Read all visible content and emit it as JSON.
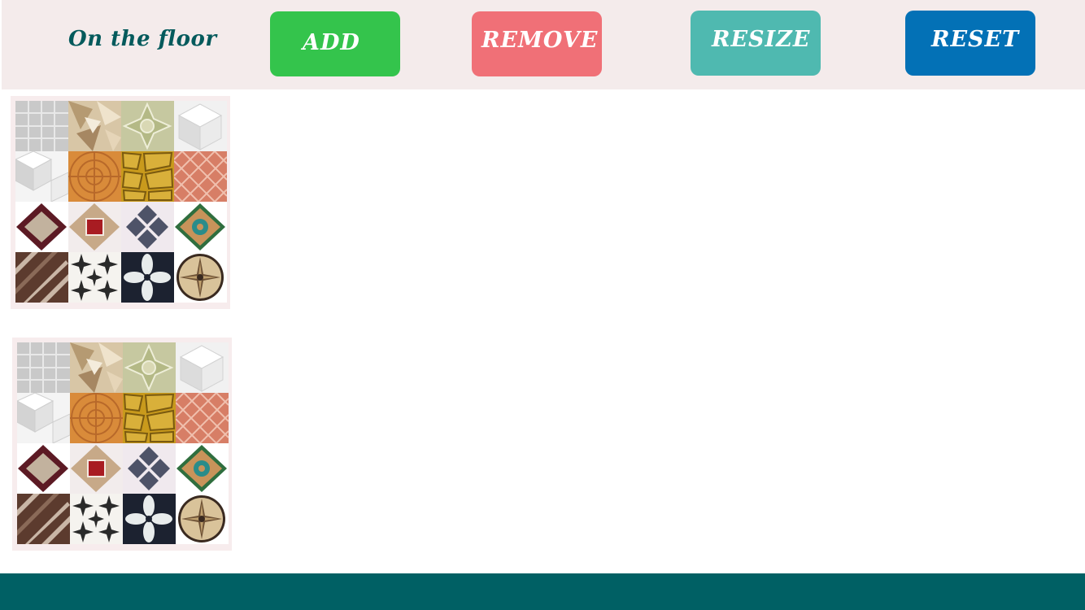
{
  "header": {
    "title": "On the floor",
    "buttons": {
      "add": "ADD",
      "remove": "REMOVE",
      "resize": "RESIZE",
      "reset": "RESET"
    }
  },
  "colors": {
    "header_bg": "#f4ebeb",
    "title": "#045a5c",
    "add": "#34c44c",
    "remove": "#f07077",
    "resize": "#4fb9b0",
    "reset": "#0371b6",
    "footer": "#006064"
  },
  "palettes": [
    {
      "name": "tile-palette-1",
      "tiles": [
        "grey-grid-tile",
        "beige-marble-mosaic-tile",
        "green-stone-star-tile",
        "white-marble-cube-tile",
        "white-marble-cube-tile-2",
        "orange-terracotta-fan-tile",
        "yellow-flagstone-tile",
        "red-brick-herringbone-tile",
        "maroon-diamond-tile",
        "beige-red-square-tile",
        "blue-grey-diamond-tile",
        "green-ornate-medallion-tile",
        "brown-basketweave-tile",
        "black-white-star-tile",
        "black-white-quatrefoil-tile",
        "gold-compass-rose-tile"
      ]
    },
    {
      "name": "tile-palette-2",
      "tiles": [
        "grey-grid-tile",
        "beige-marble-mosaic-tile",
        "green-stone-star-tile",
        "white-marble-cube-tile",
        "white-marble-cube-tile-2",
        "orange-terracotta-fan-tile",
        "yellow-flagstone-tile",
        "red-brick-herringbone-tile",
        "maroon-diamond-tile",
        "beige-red-square-tile",
        "blue-grey-diamond-tile",
        "green-ornate-medallion-tile",
        "brown-basketweave-tile",
        "black-white-star-tile",
        "black-white-quatrefoil-tile",
        "gold-compass-rose-tile"
      ]
    }
  ]
}
